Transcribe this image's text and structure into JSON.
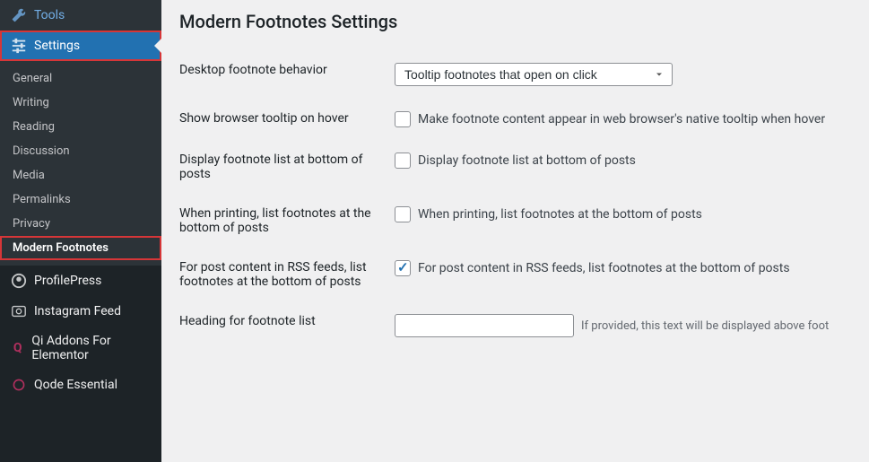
{
  "sidebar": {
    "tools": {
      "label": "Tools"
    },
    "settings": {
      "label": "Settings"
    },
    "submenu": [
      {
        "label": "General"
      },
      {
        "label": "Writing"
      },
      {
        "label": "Reading"
      },
      {
        "label": "Discussion"
      },
      {
        "label": "Media"
      },
      {
        "label": "Permalinks"
      },
      {
        "label": "Privacy"
      },
      {
        "label": "Modern Footnotes"
      }
    ],
    "profilepress": {
      "label": "ProfilePress"
    },
    "instagramfeed": {
      "label": "Instagram Feed"
    },
    "qiaddons": {
      "label": "Qi Addons For Elementor"
    },
    "qodeessential": {
      "label": "Qode Essential"
    }
  },
  "page": {
    "title": "Modern Footnotes Settings"
  },
  "form": {
    "desktop_behavior": {
      "label": "Desktop footnote behavior",
      "value": "Tooltip footnotes that open on click"
    },
    "browser_tooltip": {
      "label": "Show browser tooltip on hover",
      "checkbox_label": "Make footnote content appear in web browser's native tooltip when hover",
      "checked": false
    },
    "display_list": {
      "label": "Display footnote list at bottom of posts",
      "checkbox_label": "Display footnote list at bottom of posts",
      "checked": false
    },
    "printing": {
      "label": "When printing, list footnotes at the bottom of posts",
      "checkbox_label": "When printing, list footnotes at the bottom of posts",
      "checked": false
    },
    "rss": {
      "label": "For post content in RSS feeds, list footnotes at the bottom of posts",
      "checkbox_label": "For post content in RSS feeds, list footnotes at the bottom of posts",
      "checked": true
    },
    "heading": {
      "label": "Heading for footnote list",
      "help_text": "If provided, this text will be displayed above foot",
      "value": ""
    }
  }
}
